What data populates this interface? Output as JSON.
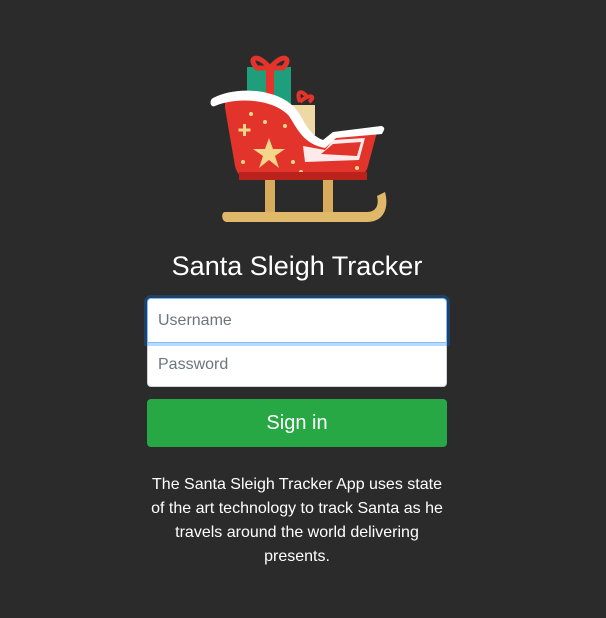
{
  "app": {
    "title": "Santa Sleigh Tracker"
  },
  "login": {
    "username_placeholder": "Username",
    "username_value": "",
    "password_placeholder": "Password",
    "password_value": "",
    "signin_label": "Sign in"
  },
  "description": "The Santa Sleigh Tracker App uses state of the art technology to track Santa as he travels around the world delivering presents.",
  "colors": {
    "background": "#2b2b2b",
    "primary_button": "#28a745",
    "sleigh_red": "#e2342a",
    "sleigh_runner": "#e0b86a",
    "focus_ring": "#80bdff"
  },
  "icons": {
    "logo": "sleigh-with-gifts-icon"
  }
}
